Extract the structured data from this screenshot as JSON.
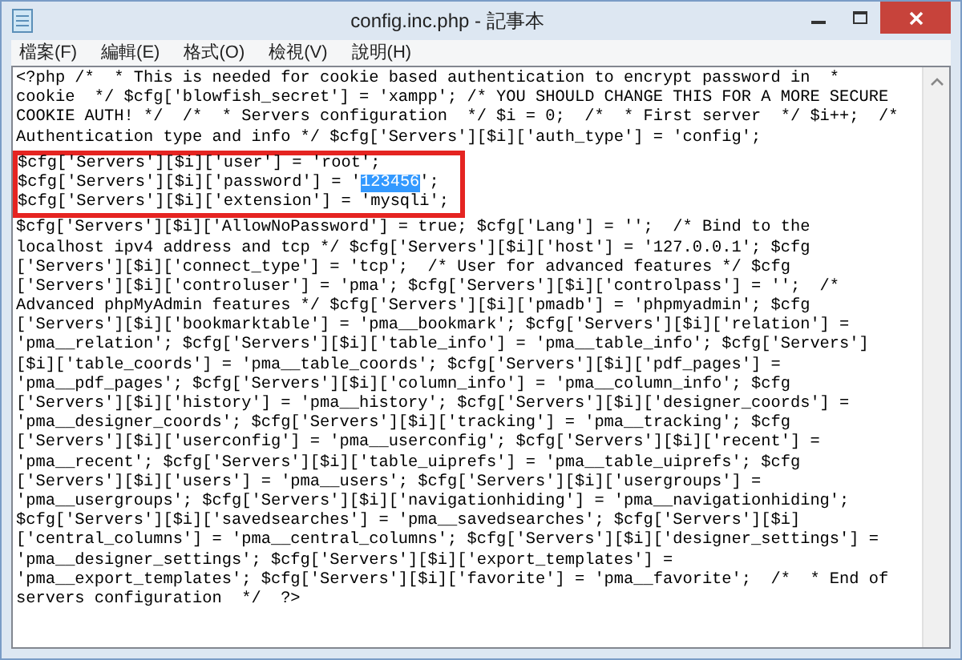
{
  "window": {
    "title": "config.inc.php - 記事本"
  },
  "menu": [
    {
      "label": "檔案(F)"
    },
    {
      "label": "編輯(E)"
    },
    {
      "label": "格式(O)"
    },
    {
      "label": "檢視(V)"
    },
    {
      "label": "說明(H)"
    }
  ],
  "lines": [
    {
      "text": "<?php /*  * This is needed for cookie based authentication to encrypt password in  *",
      "boxed": false
    },
    {
      "text": "cookie  */ $cfg['blowfish_secret'] = 'xampp'; /* YOU SHOULD CHANGE THIS FOR A MORE SECURE",
      "boxed": false
    },
    {
      "text": "COOKIE AUTH! */  /*  * Servers configuration  */ $i = 0;  /*  * First server  */ $i++;  /*",
      "boxed": false
    },
    {
      "text": "Authentication type and info */ $cfg['Servers'][$i]['auth_type'] = 'config';",
      "boxed": false
    },
    {
      "text": "$cfg['Servers'][$i]['user'] = 'root';",
      "boxed": true
    },
    {
      "text": "$cfg['Servers'][$i]['password'] = '",
      "selected_text": "123456",
      "text_after": "';",
      "boxed": true
    },
    {
      "text": "$cfg['Servers'][$i]['extension'] = 'mysqli';",
      "boxed": true
    },
    {
      "text": "$cfg['Servers'][$i]['AllowNoPassword'] = true; $cfg['Lang'] = '';  /* Bind to the",
      "boxed": false
    },
    {
      "text": "localhost ipv4 address and tcp */ $cfg['Servers'][$i]['host'] = '127.0.0.1'; $cfg",
      "boxed": false
    },
    {
      "text": "['Servers'][$i]['connect_type'] = 'tcp';  /* User for advanced features */ $cfg",
      "boxed": false
    },
    {
      "text": "['Servers'][$i]['controluser'] = 'pma'; $cfg['Servers'][$i]['controlpass'] = '';  /*",
      "boxed": false
    },
    {
      "text": "Advanced phpMyAdmin features */ $cfg['Servers'][$i]['pmadb'] = 'phpmyadmin'; $cfg",
      "boxed": false
    },
    {
      "text": "['Servers'][$i]['bookmarktable'] = 'pma__bookmark'; $cfg['Servers'][$i]['relation'] =",
      "boxed": false
    },
    {
      "text": "'pma__relation'; $cfg['Servers'][$i]['table_info'] = 'pma__table_info'; $cfg['Servers']",
      "boxed": false
    },
    {
      "text": "[$i]['table_coords'] = 'pma__table_coords'; $cfg['Servers'][$i]['pdf_pages'] =",
      "boxed": false
    },
    {
      "text": "'pma__pdf_pages'; $cfg['Servers'][$i]['column_info'] = 'pma__column_info'; $cfg",
      "boxed": false
    },
    {
      "text": "['Servers'][$i]['history'] = 'pma__history'; $cfg['Servers'][$i]['designer_coords'] =",
      "boxed": false
    },
    {
      "text": "'pma__designer_coords'; $cfg['Servers'][$i]['tracking'] = 'pma__tracking'; $cfg",
      "boxed": false
    },
    {
      "text": "['Servers'][$i]['userconfig'] = 'pma__userconfig'; $cfg['Servers'][$i]['recent'] =",
      "boxed": false
    },
    {
      "text": "'pma__recent'; $cfg['Servers'][$i]['table_uiprefs'] = 'pma__table_uiprefs'; $cfg",
      "boxed": false
    },
    {
      "text": "['Servers'][$i]['users'] = 'pma__users'; $cfg['Servers'][$i]['usergroups'] =",
      "boxed": false
    },
    {
      "text": "'pma__usergroups'; $cfg['Servers'][$i]['navigationhiding'] = 'pma__navigationhiding';",
      "boxed": false
    },
    {
      "text": "$cfg['Servers'][$i]['savedsearches'] = 'pma__savedsearches'; $cfg['Servers'][$i]",
      "boxed": false
    },
    {
      "text": "['central_columns'] = 'pma__central_columns'; $cfg['Servers'][$i]['designer_settings'] =",
      "boxed": false
    },
    {
      "text": "'pma__designer_settings'; $cfg['Servers'][$i]['export_templates'] =",
      "boxed": false
    },
    {
      "text": "'pma__export_templates'; $cfg['Servers'][$i]['favorite'] = 'pma__favorite';  /*  * End of",
      "boxed": false
    },
    {
      "text": "servers configuration  */  ?>",
      "boxed": false
    }
  ]
}
